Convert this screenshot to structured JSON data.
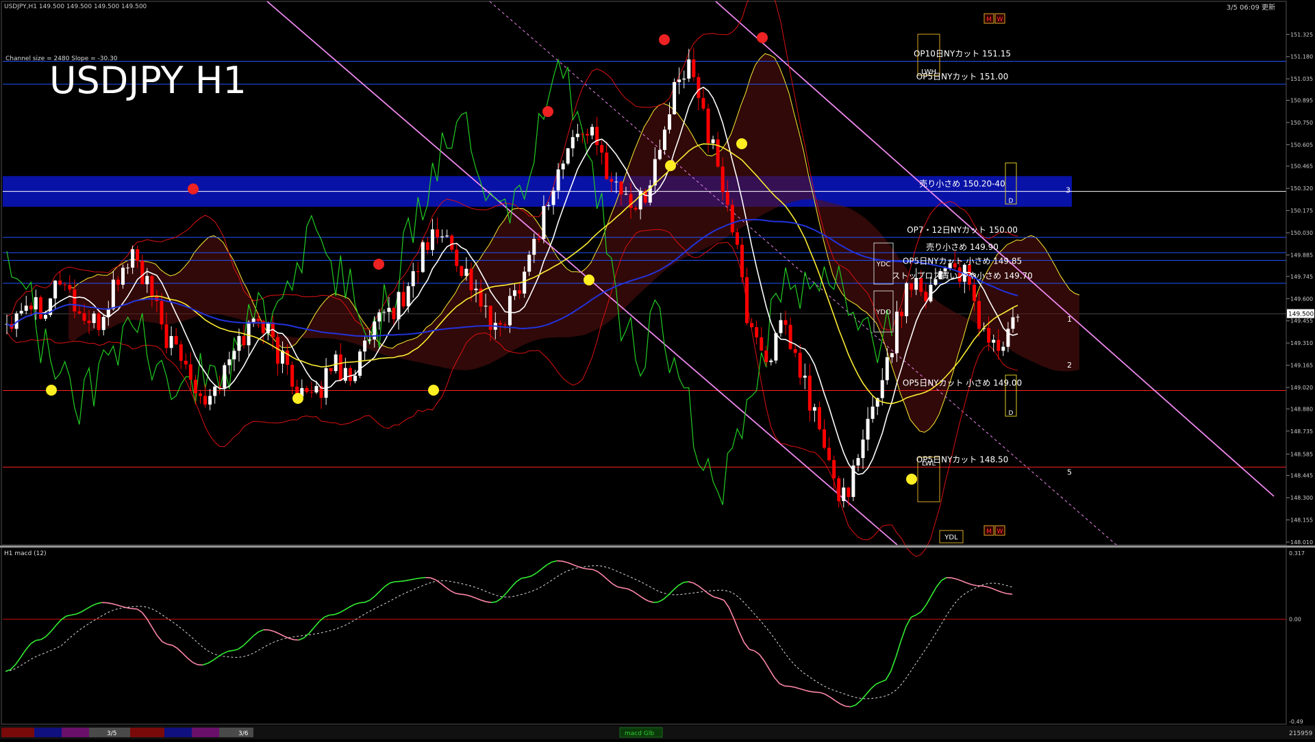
{
  "header": {
    "quote_line": "USDJPY,H1  149.500 149.500 149.500 149.500",
    "server_time": "3/5 06:09 更新",
    "channel_info": "Channel size = 2480 Slope = -30.30",
    "big_title": "USDJPY H1"
  },
  "colors": {
    "bull": "#ffffff",
    "bear": "#ff0000",
    "grid": "#2a2a2a",
    "zone": "#0a14b4",
    "channel": "#ee88ee",
    "sma_fast": "#ffffff",
    "sma_mid": "#ffee33",
    "sma_slow": "#2233dd",
    "bands": "#dd1111",
    "lagging": "#22cc22",
    "macd": "#33ee33",
    "macd_neg": "#ff88aa",
    "signal": "#dddddd"
  },
  "price_axis": {
    "min": 148.01,
    "max": 151.38,
    "ticks": [
      "151.325",
      "151.180",
      "151.035",
      "150.895",
      "150.750",
      "150.605",
      "150.465",
      "150.320",
      "150.175",
      "150.030",
      "149.885",
      "149.745",
      "149.600",
      "149.455",
      "149.310",
      "149.165",
      "149.020",
      "148.880",
      "148.735",
      "148.585",
      "148.445",
      "148.300",
      "148.155",
      "148.010"
    ],
    "current": "149.500"
  },
  "levels": [
    {
      "label": "OP10日NYカット 151.15",
      "price": 151.15,
      "color": "#2255ff"
    },
    {
      "label": "OP5日NYカット 151.00",
      "price": 151.0,
      "color": "#2255ff"
    },
    {
      "label": "売り小さめ 150.20-40",
      "price": 150.3,
      "color": "#ffffff"
    },
    {
      "label": "OP7・12日NYカット 150.00",
      "price": 150.0,
      "color": "#2255ff"
    },
    {
      "label": "売り小さめ 149.90",
      "price": 149.9,
      "color": "#2255ff"
    },
    {
      "label": "OP5日NYカット 小さめ 149.85",
      "price": 149.85,
      "color": "#2255ff"
    },
    {
      "label": "ストップロス買い やや小さめ 149.70",
      "price": 149.7,
      "color": "#2255ff"
    },
    {
      "label": "OP5日NYカット 小さめ 149.00",
      "price": 149.0,
      "color": "#ff2222"
    },
    {
      "label": "OP5日NYカット 148.50",
      "price": 148.5,
      "color": "#ff2222"
    }
  ],
  "zone": {
    "low": 150.2,
    "high": 150.4,
    "tag": "3"
  },
  "right_markers": [
    "1",
    "2",
    "5"
  ],
  "box_labels": {
    "ydc": "YDC",
    "ydo": "YDO",
    "ydl": "YDL",
    "lwh": "LWH",
    "lwl": "LWL",
    "m": "M",
    "w": "W",
    "d": "D"
  },
  "macd_panel": {
    "title": "H1  macd (12)",
    "ticks": [
      "0.317",
      "0.00",
      "-0.49"
    ],
    "min": -0.49,
    "max": 0.317
  },
  "bottom_bar": {
    "labels": [
      "3/5",
      "3/6"
    ],
    "tab": "macd Glb",
    "right_value": "215959"
  },
  "chart_data": {
    "type": "line",
    "title": "USDJPY H1",
    "symbol": "USDJPY",
    "timeframe": "H1",
    "x_labels": [
      "3/5",
      "3/6"
    ],
    "series": [],
    "ohlc_anchor_closes": [
      149.45,
      149.6,
      149.55,
      149.75,
      149.5,
      149.4,
      149.7,
      149.9,
      149.6,
      149.3,
      149.15,
      148.95,
      149.1,
      149.35,
      149.5,
      149.25,
      149.05,
      148.9,
      149.2,
      149.1,
      149.3,
      149.5,
      149.6,
      149.9,
      150.05,
      149.85,
      149.65,
      149.35,
      149.6,
      149.9,
      150.25,
      150.55,
      150.75,
      150.5,
      150.3,
      150.2,
      150.5,
      150.95,
      151.15,
      150.6,
      150.2,
      149.5,
      149.2,
      149.4,
      149.1,
      148.75,
      148.3,
      148.45,
      148.9,
      149.3,
      149.75,
      149.65,
      149.85,
      149.75,
      149.4,
      149.25,
      149.5
    ],
    "macd_anchor": [
      -0.25,
      -0.1,
      0.02,
      0.08,
      0.05,
      -0.12,
      -0.22,
      -0.15,
      -0.05,
      -0.1,
      0.02,
      0.08,
      0.18,
      0.2,
      0.12,
      0.08,
      0.2,
      0.28,
      0.24,
      0.15,
      0.08,
      0.18,
      0.1,
      -0.15,
      -0.32,
      -0.35,
      -0.42,
      -0.3,
      0.02,
      0.2,
      0.16,
      0.12
    ]
  }
}
